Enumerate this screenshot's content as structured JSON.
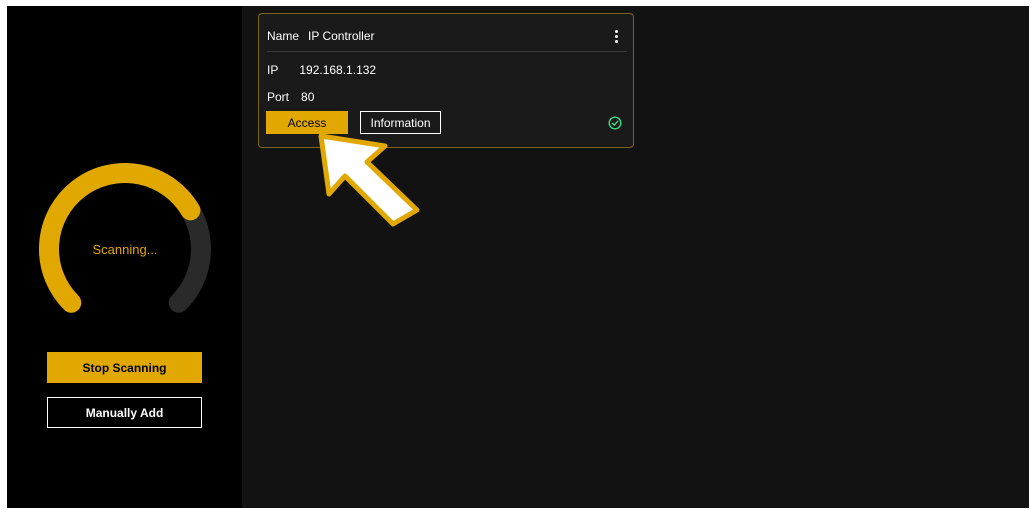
{
  "sidebar": {
    "scan_status": "Scanning...",
    "scan_progress": 0.72,
    "stop_button": "Stop Scanning",
    "manual_button": "Manually Add"
  },
  "device_card": {
    "name_label": "Name",
    "name_value": "IP Controller",
    "ip_label": "IP",
    "ip_value": "192.168.1.132",
    "port_label": "Port",
    "port_value": "80",
    "access_button": "Access",
    "info_button": "Information",
    "status_icon": "check-circle-icon"
  },
  "colors": {
    "accent": "#e0a800",
    "background": "#121212",
    "sidebar": "#000000",
    "ring_track": "#2a2a2a"
  }
}
